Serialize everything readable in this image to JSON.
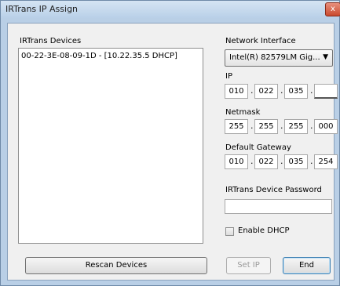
{
  "window": {
    "title": "IRTrans IP Assign",
    "close_label": "x"
  },
  "devices": {
    "label": "IRTrans Devices",
    "items": [
      "00-22-3E-08-09-1D  -  [10.22.35.5 DHCP]"
    ]
  },
  "network_interface": {
    "label": "Network Interface",
    "selected": "Intel(R) 82579LM Gig..."
  },
  "ip": {
    "label": "IP",
    "octets": [
      "010",
      "022",
      "035",
      ""
    ]
  },
  "netmask": {
    "label": "Netmask",
    "octets": [
      "255",
      "255",
      "255",
      "000"
    ]
  },
  "gateway": {
    "label": "Default Gateway",
    "octets": [
      "010",
      "022",
      "035",
      "254"
    ]
  },
  "password": {
    "label": "IRTrans Device Password",
    "value": ""
  },
  "dhcp": {
    "label": "Enable DHCP",
    "checked": false
  },
  "buttons": {
    "rescan": "Rescan Devices",
    "set_ip": "Set IP",
    "end": "End"
  }
}
